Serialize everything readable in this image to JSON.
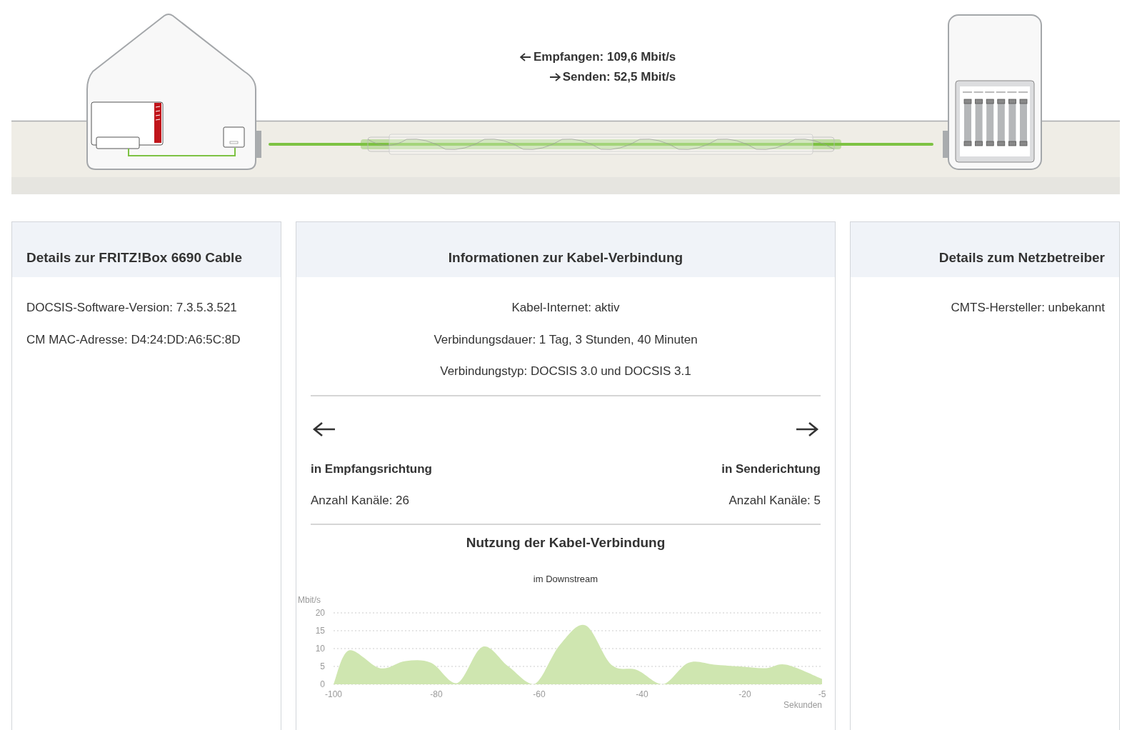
{
  "connection": {
    "receive": "Empfangen: 109,6 Mbit/s",
    "send": "Senden: 52,5 Mbit/s"
  },
  "panels": [
    {
      "title": "Details zur FRITZ!Box 6690 Cable",
      "kind": "device",
      "lines": [
        "DOCSIS-Software-Version: 7.3.5.3.521",
        "CM MAC-Adresse: D4:24:DD:A6:5C:8D"
      ]
    },
    {
      "title": "Informationen zur Kabel-Verbindung",
      "kind": "connection",
      "lines": [
        "Kabel-Internet: aktiv",
        "Verbindungsdauer: 1 Tag, 3 Stunden, 40 Minuten",
        "Verbindungstyp: DOCSIS 3.0 und DOCSIS 3.1"
      ],
      "directions": [
        {
          "kind": "receive",
          "label": "in Empfangsrichtung",
          "channels": "Anzahl Kanäle: 26"
        },
        {
          "kind": "send",
          "label": "in Senderichtung",
          "channels": "Anzahl Kanäle: 5"
        }
      ],
      "usage": {
        "title": "Nutzung der Kabel-Verbindung",
        "chart_data": {
          "type": "area",
          "title": "im Downstream",
          "xlabel": "Sekunden",
          "ylabel": "Mbit/s",
          "x": [
            -100,
            -97,
            -91,
            -86,
            -81,
            -76,
            -71,
            -66,
            -61,
            -56,
            -51,
            -46,
            -41,
            -36,
            -31,
            -26,
            -21,
            -16,
            -12,
            -5
          ],
          "series": [
            {
              "color": "#cfe6b0",
              "values": [
                0,
                9.5,
                4.5,
                6.5,
                6,
                0.3,
                10.5,
                5,
                0,
                11,
                16.5,
                5.5,
                4,
                0,
                6,
                5.5,
                5,
                4.5,
                5.5,
                1.5
              ]
            }
          ],
          "xlim": [
            -100,
            -5
          ],
          "ylim": [
            0,
            20
          ],
          "xticks": [
            -100,
            -80,
            -60,
            -40,
            -20,
            -5
          ],
          "yticks": [
            0,
            5,
            10,
            15,
            20
          ],
          "grid": true
        }
      }
    },
    {
      "title": "Details zum Netzbetreiber",
      "kind": "operator",
      "lines": [
        "CMTS-Hersteller: unbekannt"
      ]
    }
  ]
}
